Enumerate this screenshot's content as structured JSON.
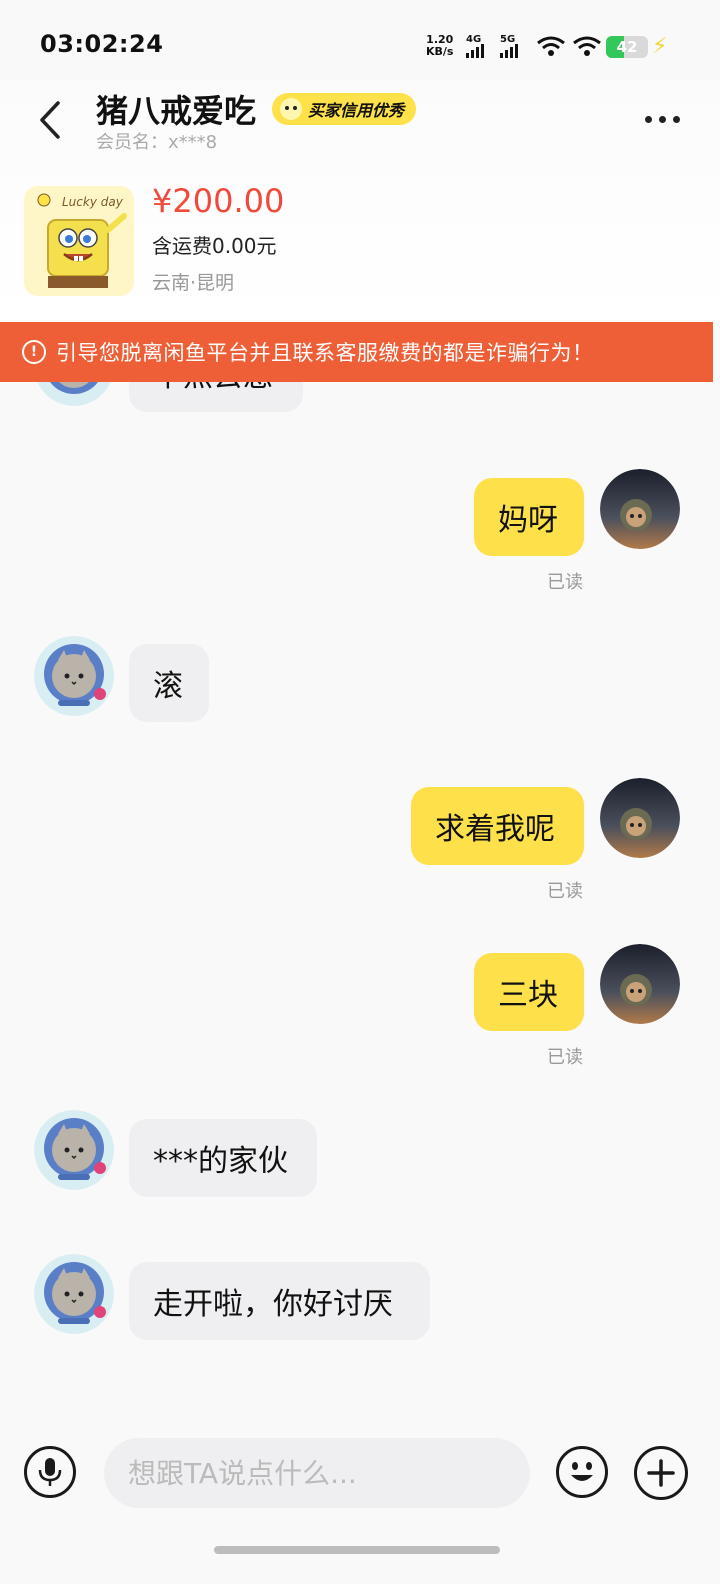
{
  "status_bar": {
    "time": "03:02:24",
    "net_speed": "1.20",
    "net_unit": "KB/s",
    "signal_1": "4G",
    "signal_2": "5G",
    "battery": "42"
  },
  "header": {
    "seller_name": "猪八戒爱吃",
    "credit_badge": "买家信用优秀",
    "member_label": "会员名：x***8"
  },
  "product": {
    "image_caption": "Lucky day",
    "price": "¥200.00",
    "shipping": "含运费0.00元",
    "location": "云南·昆明"
  },
  "warning": {
    "icon": "!",
    "text": "引导您脱离闲鱼平台并且联系客服缴费的都是诈骗行为！"
  },
  "messages": [
    {
      "side": "in",
      "text": "早点去急"
    },
    {
      "side": "out",
      "text": "妈呀",
      "status": "已读"
    },
    {
      "side": "in",
      "text": "滚"
    },
    {
      "side": "out",
      "text": "求着我呢",
      "status": "已读"
    },
    {
      "side": "out",
      "text": "三块",
      "status": "已读"
    },
    {
      "side": "in",
      "text": "***的家伙"
    },
    {
      "side": "in",
      "text": "走开啦，你好讨厌"
    }
  ],
  "input": {
    "placeholder": "想跟TA说点什么..."
  },
  "colors": {
    "accent_yellow": "#fde04a",
    "warning_orange": "#ee5f37",
    "price_red": "#f04a3b"
  }
}
